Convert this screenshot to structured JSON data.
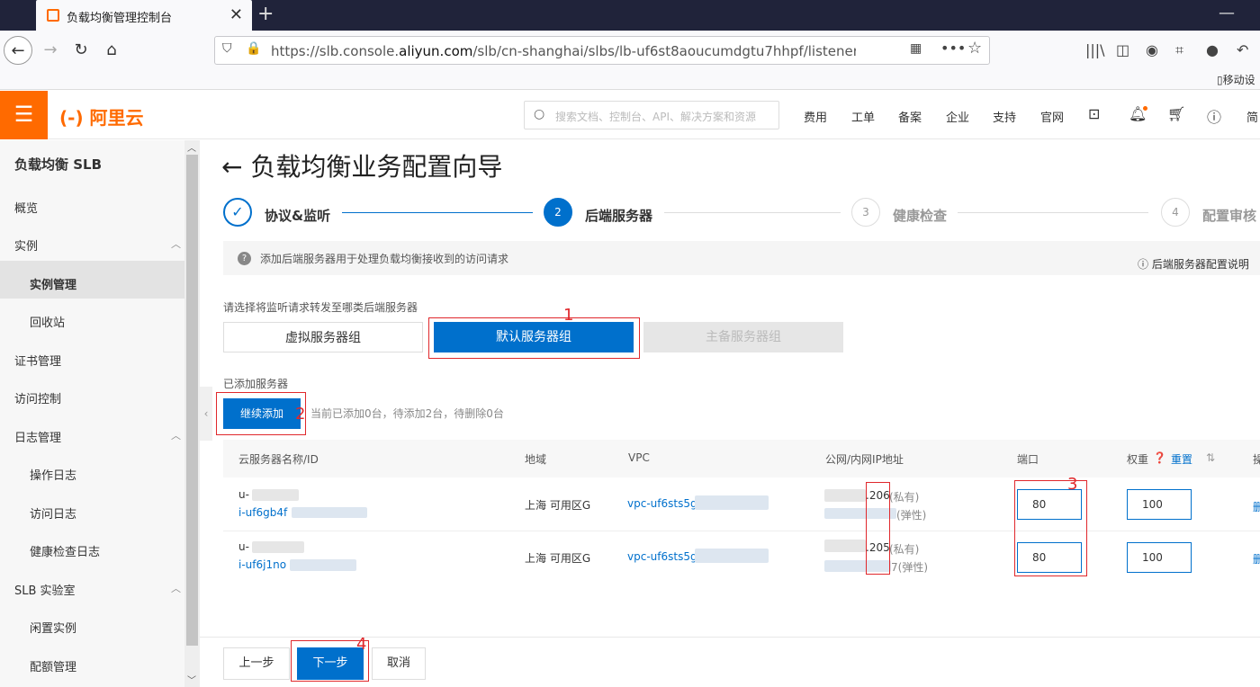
{
  "browser": {
    "tab_title": "负载均衡管理控制台",
    "url_prefix": "https://slb.console.",
    "url_domain": "aliyun.com",
    "url_rest": "/slb/cn-shanghai/slbs/lb-uf6st8aoucumdgtu7hhpf/listeners/new?redire",
    "bookmark": "移动设"
  },
  "header": {
    "logo": "(-) 阿里云",
    "search_placeholder": "搜索文档、控制台、API、解决方案和资源",
    "nav": [
      "费用",
      "工单",
      "备案",
      "企业",
      "支持",
      "官网"
    ],
    "lang": "简"
  },
  "sidebar": {
    "title": "负载均衡 SLB",
    "items": [
      {
        "label": "概览"
      },
      {
        "label": "实例"
      },
      {
        "label": "实例管理"
      },
      {
        "label": "回收站"
      },
      {
        "label": "证书管理"
      },
      {
        "label": "访问控制"
      },
      {
        "label": "日志管理"
      },
      {
        "label": "操作日志"
      },
      {
        "label": "访问日志"
      },
      {
        "label": "健康检查日志"
      },
      {
        "label": "SLB 实验室"
      },
      {
        "label": "闲置实例"
      },
      {
        "label": "配额管理"
      }
    ]
  },
  "wizard": {
    "title": "负载均衡业务配置向导",
    "steps": [
      {
        "num": "✓",
        "label": "协议&监听"
      },
      {
        "num": "2",
        "label": "后端服务器"
      },
      {
        "num": "3",
        "label": "健康检查"
      },
      {
        "num": "4",
        "label": "配置审核"
      }
    ]
  },
  "info": {
    "text": "添加后端服务器用于处理负载均衡接收到的访问请求",
    "help": "后端服务器配置说明"
  },
  "server_type": {
    "label": "请选择将监听请求转发至哪类后端服务器",
    "options": [
      "虚拟服务器组",
      "默认服务器组",
      "主备服务器组"
    ]
  },
  "added": {
    "label": "已添加服务器",
    "continue_label": "继续添加",
    "status": "当前已添加0台，待添加2台，待删除0台"
  },
  "table": {
    "headers": [
      "云服务器名称/ID",
      "地域",
      "VPC",
      "公网/内网IP地址",
      "端口",
      "权重",
      "重置",
      "操"
    ],
    "rows": [
      {
        "name": "u-",
        "id": "i-uf6gb4f",
        "region": "上海 可用区G",
        "vpc": "vpc-uf6sts5g",
        "ip_private": ".206",
        "tag_private": "(私有)",
        "tag_public": "(弹性)",
        "port": "80",
        "weight": "100",
        "op": "删"
      },
      {
        "name": "u-",
        "id": "i-uf6j1no",
        "region": "上海 可用区G",
        "vpc": "vpc-uf6sts5g",
        "ip_private": ".205",
        "tag_private": "(私有)",
        "tag_public": "7(弹性)",
        "port": "80",
        "weight": "100",
        "op": "删"
      }
    ]
  },
  "annotations": [
    "1",
    "2",
    "3",
    "4"
  ],
  "footer": {
    "prev": "上一步",
    "next": "下一步",
    "cancel": "取消"
  },
  "colors": {
    "brand": "#ff6a00",
    "primary": "#0070cc",
    "annotation": "#e0282c"
  }
}
